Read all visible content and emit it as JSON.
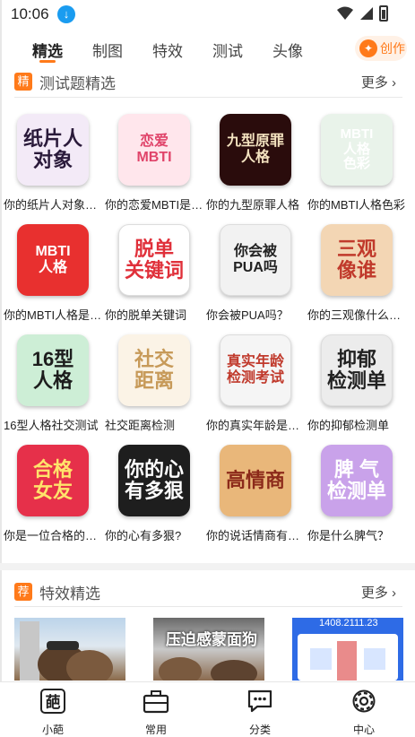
{
  "status": {
    "time": "10:06"
  },
  "tabs": [
    "精选",
    "制图",
    "特效",
    "测试",
    "头像"
  ],
  "create_label": "创作",
  "quiz_section": {
    "badge": "精",
    "title": "测试题精选",
    "more": "更多",
    "items": [
      {
        "thumb_text": "纸片人\n对象",
        "caption": "你的纸片人对象是谁？",
        "bg": "#f3eaf7",
        "fg": "#2a1a3a"
      },
      {
        "thumb_text": "恋爱\nMBTI",
        "caption": "你的恋爱MBTI是什么？",
        "bg": "#ffe6ec",
        "fg": "#e0446a"
      },
      {
        "thumb_text": "九型原罪\n人格",
        "caption": "你的九型原罪人格",
        "bg": "#2a0c0c",
        "fg": "#f4e3c0"
      },
      {
        "thumb_text": "MBTI\n人格\n色彩",
        "caption": "你的MBTI人格色彩",
        "bg": "#e9f3ea",
        "fg": "#ffffff"
      },
      {
        "thumb_text": "MBTI\n人格",
        "caption": "你的MBTI人格是什么？",
        "bg": "#e8302f",
        "fg": "#ffffff"
      },
      {
        "thumb_text": "脱单\n关键词",
        "caption": "你的脱单关键词",
        "bg": "#ffffff",
        "fg": "#e0303a"
      },
      {
        "thumb_text": "你会被\nPUA吗",
        "caption": "你会被PUA吗？",
        "bg": "#f2f2f2",
        "fg": "#222222"
      },
      {
        "thumb_text": "三观\n像谁",
        "caption": "你的三观像什么人？",
        "bg": "#f3d6b4",
        "fg": "#c0392b"
      },
      {
        "thumb_text": "16型\n人格",
        "caption": "16型人格社交测试",
        "bg": "#cdeed6",
        "fg": "#1d1d1d"
      },
      {
        "thumb_text": "社交\n距离",
        "caption": "社交距离检测",
        "bg": "#fbf3e6",
        "fg": "#c79a59"
      },
      {
        "thumb_text": "真实年龄\n检测考试",
        "caption": "你的真实年龄是多少？",
        "bg": "#f5f5f5",
        "fg": "#c0392b"
      },
      {
        "thumb_text": "抑郁\n检测单",
        "caption": "你的抑郁检测单",
        "bg": "#ececec",
        "fg": "#222222"
      },
      {
        "thumb_text": "合格\n女友",
        "caption": "你是一位合格的女友吗？",
        "bg": "#e6304a",
        "fg": "#ffe36b"
      },
      {
        "thumb_text": "你的心\n有多狠",
        "caption": "你的心有多狠?",
        "bg": "#1e1e1e",
        "fg": "#ffffff"
      },
      {
        "thumb_text": "高情商",
        "caption": "你的说话情商有多高？",
        "bg": "#e9b77a",
        "fg": "#8c2a1a"
      },
      {
        "thumb_text": "脾 气\n检测单",
        "caption": "你是什么脾气？",
        "bg": "#c9a2ea",
        "fg": "#ffffff"
      }
    ]
  },
  "effects_section": {
    "badge": "荐",
    "title": "特效精选",
    "more": "更多",
    "items": [
      {
        "overlay_text": ""
      },
      {
        "overlay_text": "压迫感蒙面狗"
      },
      {
        "overlay_text": "1408.2111.23"
      }
    ]
  },
  "bottom_nav": [
    {
      "label": "小葩",
      "icon_char": "葩"
    },
    {
      "label": "常用"
    },
    {
      "label": "分类"
    },
    {
      "label": "中心"
    }
  ]
}
